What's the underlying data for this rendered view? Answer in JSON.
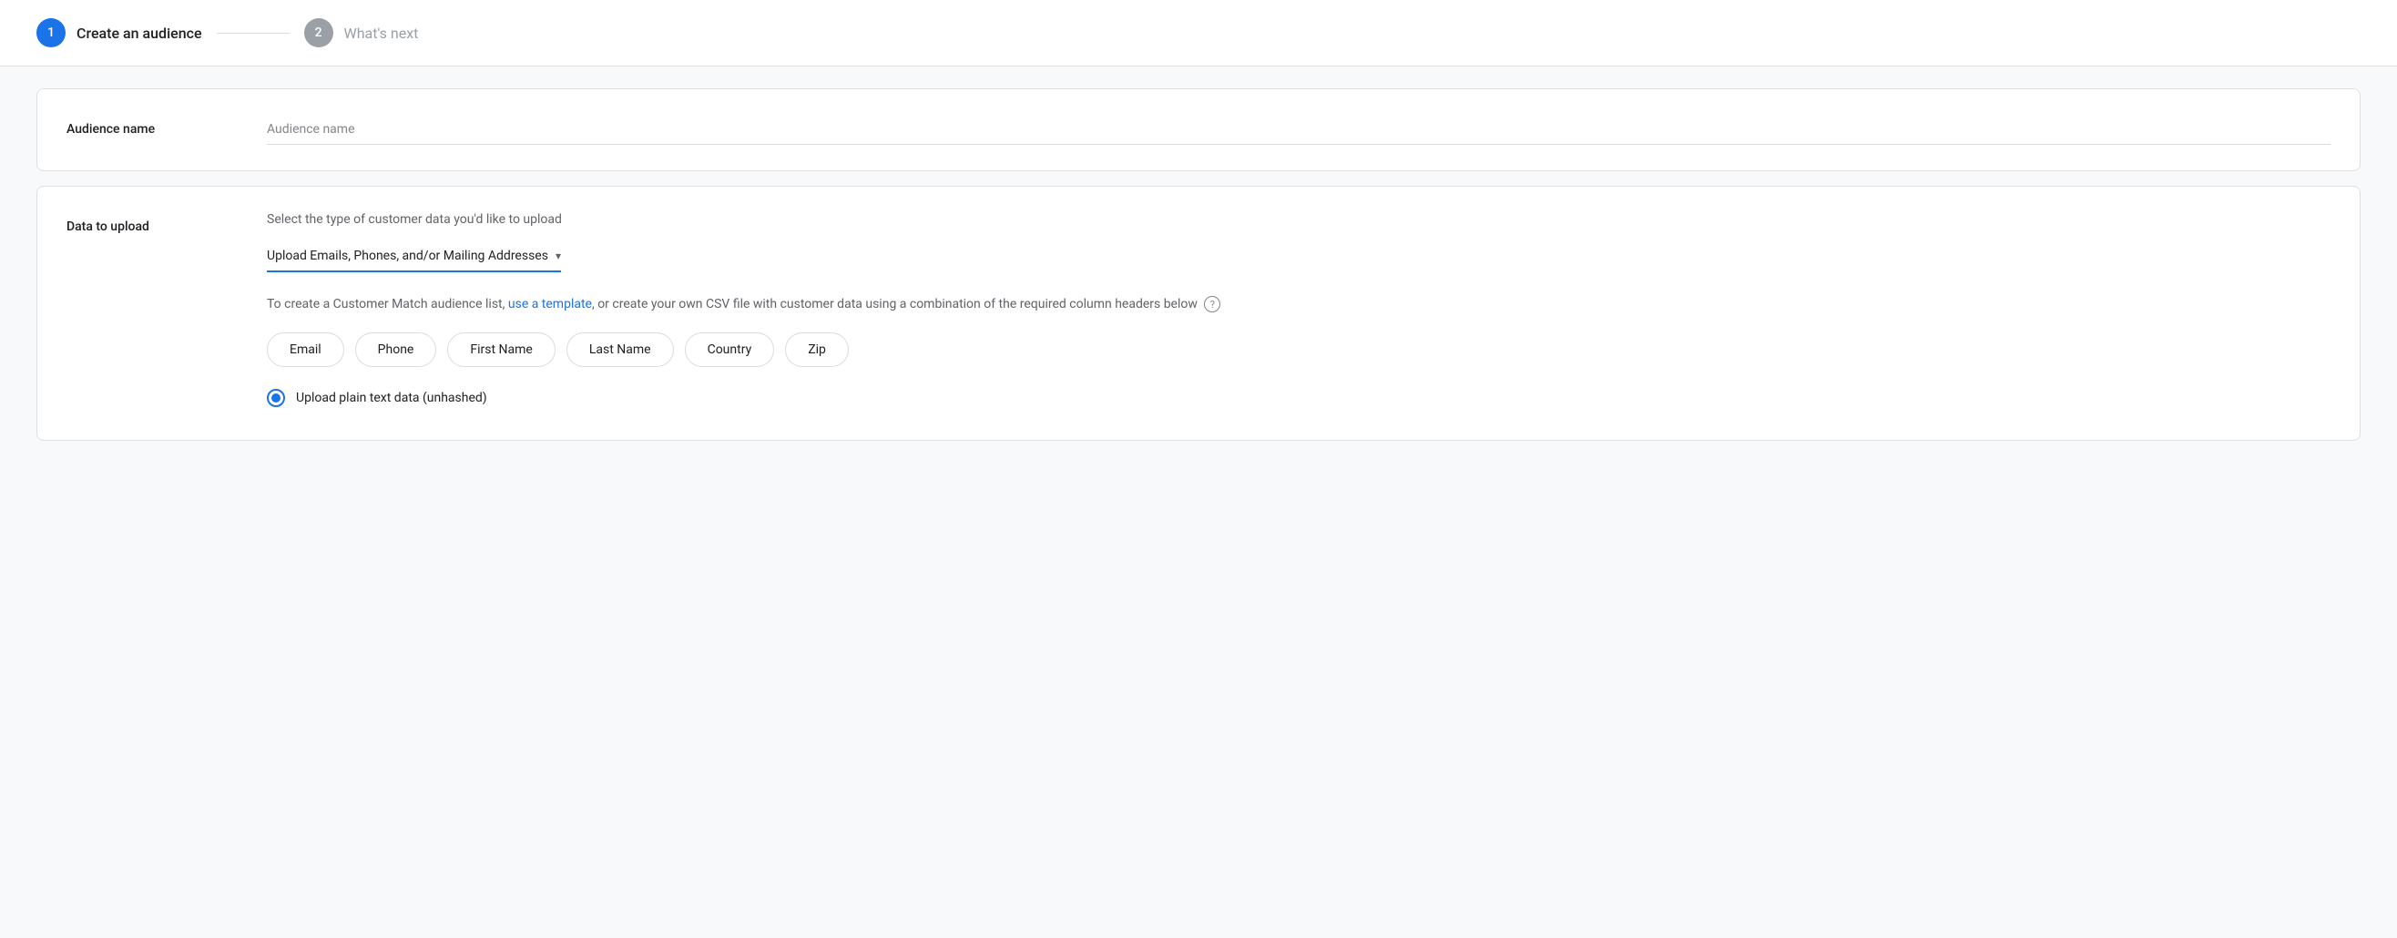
{
  "stepper": {
    "step1": {
      "number": "1",
      "label": "Create an audience",
      "state": "active"
    },
    "connector": "—",
    "step2": {
      "number": "2",
      "label": "What's next",
      "state": "inactive"
    }
  },
  "audience_name_section": {
    "label": "Audience name",
    "input_placeholder": "Audience name"
  },
  "data_upload_section": {
    "label": "Data to upload",
    "description": "Select the type of customer data you'd like to upload",
    "dropdown_value": "Upload Emails, Phones, and/or Mailing Addresses",
    "helper_text_prefix": "To create a Customer Match audience list, ",
    "helper_link": "use a template",
    "helper_text_suffix": ", or create your own CSV file with customer data using a combination of the required column headers below",
    "column_chips": [
      {
        "label": "Email"
      },
      {
        "label": "Phone"
      },
      {
        "label": "First Name"
      },
      {
        "label": "Last Name"
      },
      {
        "label": "Country"
      },
      {
        "label": "Zip"
      }
    ],
    "radio_option": {
      "label": "Upload plain text data (unhashed)",
      "selected": true
    }
  }
}
